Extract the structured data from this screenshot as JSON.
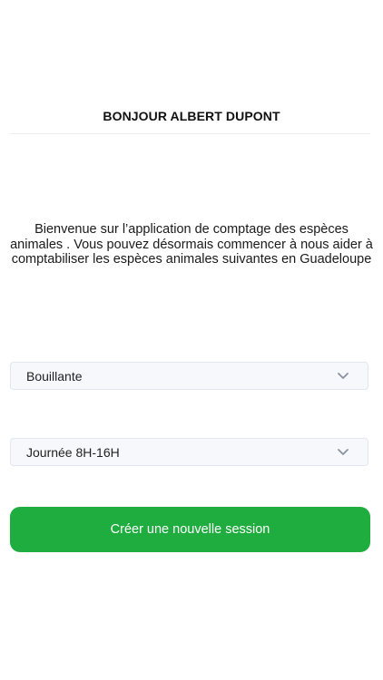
{
  "header": {
    "title": "BONJOUR ALBERT DUPONT"
  },
  "main": {
    "welcome_text": "Bienvenue sur l’application de comptage des espèces animales . Vous pouvez désormais commencer à nous aider à comptabiliser les espèces animales suivantes en Guadeloupe",
    "location_select": {
      "value": "Bouillante",
      "icon": "chevron-down-icon"
    },
    "time_select": {
      "value": "Journée 8H-16H",
      "icon": "chevron-down-icon"
    },
    "create_button_label": "Créer une nouvelle session"
  },
  "colors": {
    "accent": "#20ad3f",
    "select_background": "#f6f8fc",
    "select_border": "#e1e6f0",
    "chevron": "#8a92a0"
  }
}
